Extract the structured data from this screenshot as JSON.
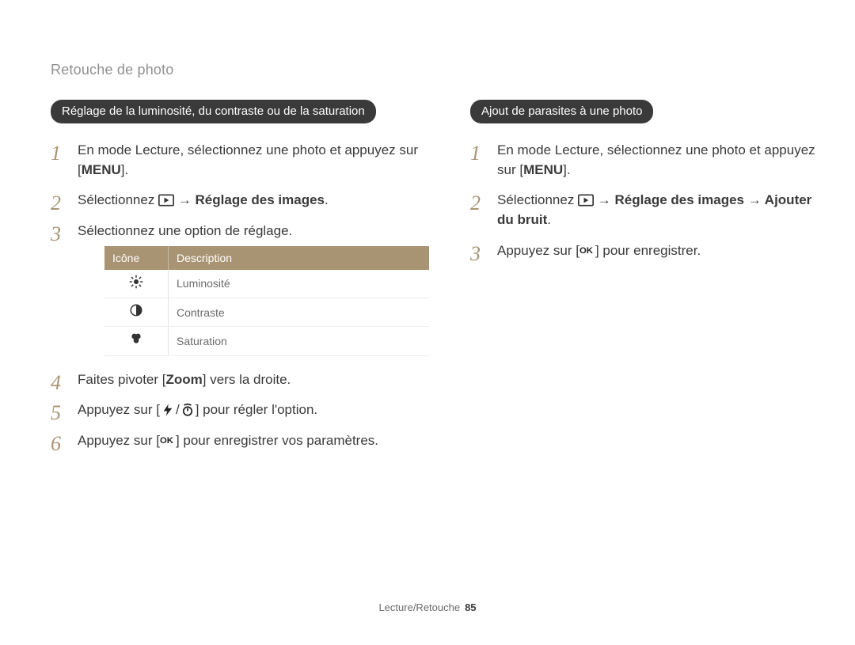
{
  "page_title": "Retouche de photo",
  "left": {
    "heading": "Réglage de la luminosité, du contraste ou de la saturation",
    "step1a": "En mode Lecture, sélectionnez une photo et appuyez sur [",
    "step1b": "MENU",
    "step1c": "].",
    "step2a": "Sélectionnez ",
    "step2b": " → Réglage des images",
    "step2c": ".",
    "step3": "Sélectionnez une option de réglage.",
    "table": {
      "head_icon": "Icône",
      "head_desc": "Description",
      "rows": [
        {
          "desc": "Luminosité"
        },
        {
          "desc": "Contraste"
        },
        {
          "desc": "Saturation"
        }
      ]
    },
    "step4a": "Faites pivoter [",
    "step4b": "Zoom",
    "step4c": "] vers la droite.",
    "step5a": "Appuyez sur [",
    "step5b": "/",
    "step5c": "] pour régler l'option.",
    "step6a": "Appuyez sur [",
    "step6b": "] pour enregistrer vos paramètres."
  },
  "right": {
    "heading": "Ajout de parasites à une photo",
    "step1a": "En mode Lecture, sélectionnez une photo et appuyez sur [",
    "step1b": "MENU",
    "step1c": "].",
    "step2a": "Sélectionnez ",
    "step2b": " → Réglage des images → Ajouter du bruit",
    "step2c": ".",
    "step3a": "Appuyez sur [",
    "step3b": "] pour enregistrer."
  },
  "footer": {
    "section": "Lecture/Retouche",
    "page": "85"
  }
}
